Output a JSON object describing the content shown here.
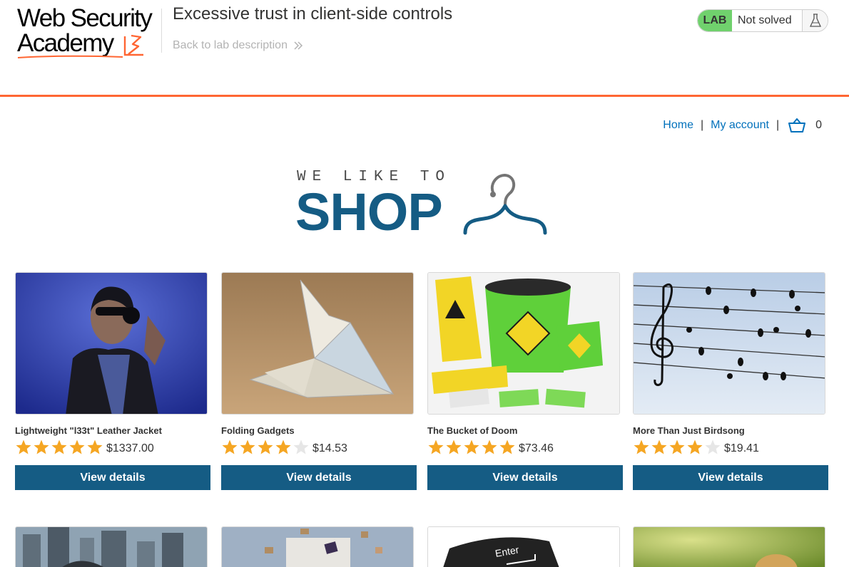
{
  "academy": {
    "logo_line1": "Web Security",
    "logo_line2": "Academy",
    "lab_title": "Excessive trust in client-side controls",
    "back_link": "Back to lab description",
    "lab_badge": "LAB",
    "lab_state": "Not solved"
  },
  "nav": {
    "home": "Home",
    "separator": "|",
    "my_account": "My account",
    "cart_count": "0"
  },
  "banner": {
    "small_text": "WE LIKE TO",
    "big_text": "SHOP"
  },
  "products": [
    {
      "name": "Lightweight \"l33t\" Leather Jacket",
      "price": "$1337.00",
      "rating": 5,
      "button": "View details"
    },
    {
      "name": "Folding Gadgets",
      "price": "$14.53",
      "rating": 4,
      "button": "View details"
    },
    {
      "name": "The Bucket of Doom",
      "price": "$73.46",
      "rating": 5,
      "button": "View details"
    },
    {
      "name": "More Than Just Birdsong",
      "price": "$19.41",
      "rating": 4,
      "button": "View details"
    }
  ],
  "colors": {
    "accent_orange": "#ff6633",
    "brand_blue": "#155c84",
    "link_blue": "#0071bc",
    "lab_green": "#70d16d",
    "star_gold": "#f5a623",
    "star_empty": "#e6e6e6"
  },
  "icons": {
    "cart": "basket-icon",
    "flask": "flask-icon",
    "back": "double-chevron-right-icon",
    "hanger": "hanger-icon"
  }
}
